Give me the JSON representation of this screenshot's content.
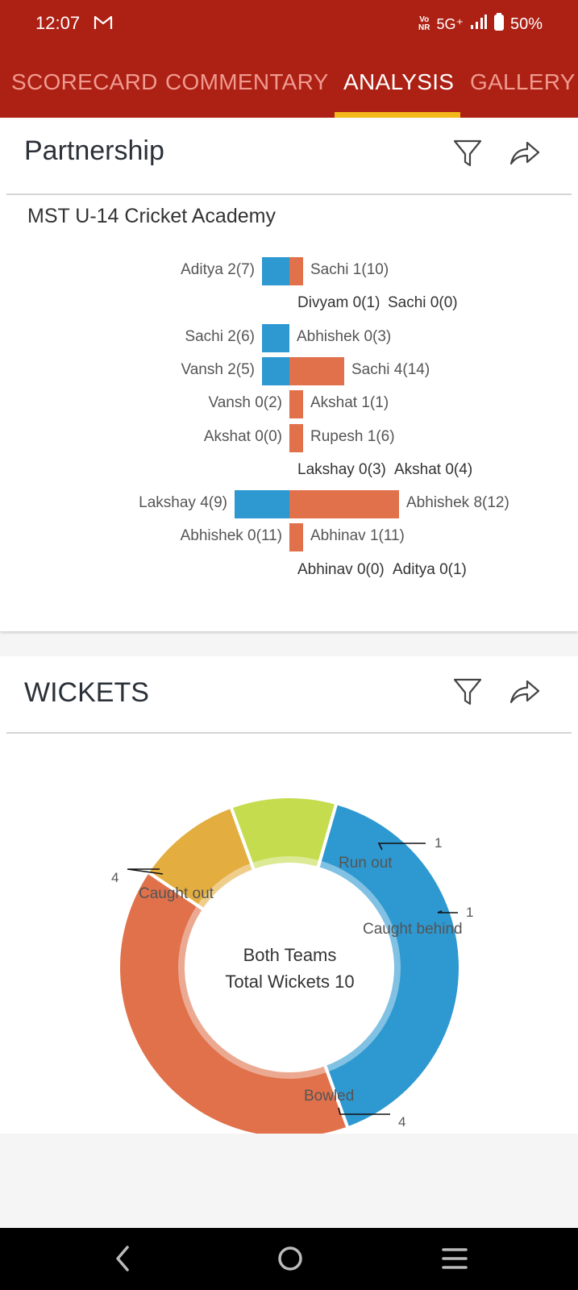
{
  "status_bar": {
    "time": "12:07",
    "network": "5G⁺",
    "battery": "50%",
    "icons": [
      "gmail-icon",
      "volte-icon",
      "signal-icon",
      "battery-icon"
    ]
  },
  "tabs": [
    {
      "label": "SCORECARD",
      "active": false
    },
    {
      "label": "COMMENTARY",
      "active": false
    },
    {
      "label": "ANALYSIS",
      "active": true
    },
    {
      "label": "GALLERY",
      "active": false
    }
  ],
  "partnership": {
    "title": "Partnership",
    "team": "MST U-14 Cricket Academy",
    "rows": [
      {
        "left": "Aditya 2(7)",
        "right": "Sachi 1(10)",
        "left_runs": 2,
        "right_runs": 1
      },
      {
        "left": "Divyam 0(1)",
        "right": "Sachi 0(0)",
        "left_runs": 0,
        "right_runs": 0
      },
      {
        "left": "Sachi 2(6)",
        "right": "Abhishek 0(3)",
        "left_runs": 2,
        "right_runs": 0
      },
      {
        "left": "Vansh 2(5)",
        "right": "Sachi 4(14)",
        "left_runs": 2,
        "right_runs": 4
      },
      {
        "left": "Vansh 0(2)",
        "right": "Akshat 1(1)",
        "left_runs": 0,
        "right_runs": 1
      },
      {
        "left": "Akshat 0(0)",
        "right": "Rupesh 1(6)",
        "left_runs": 0,
        "right_runs": 1
      },
      {
        "left": "Lakshay 0(3)",
        "right": "Akshat 0(4)",
        "left_runs": 0,
        "right_runs": 0
      },
      {
        "left": "Lakshay 4(9)",
        "right": "Abhishek 8(12)",
        "left_runs": 4,
        "right_runs": 8
      },
      {
        "left": "Abhishek 0(11)",
        "right": "Abhinav 1(11)",
        "left_runs": 0,
        "right_runs": 1
      },
      {
        "left": "Abhinav 0(0)",
        "right": "Aditya 0(1)",
        "left_runs": 0,
        "right_runs": 0
      }
    ]
  },
  "wickets": {
    "title": "WICKETS",
    "center_line1": "Both Teams",
    "center_line2": "Total Wickets 10",
    "chart_data": {
      "type": "pie",
      "style": "donut",
      "categories": [
        "Run out",
        "Caught behind",
        "Bowled",
        "Caught out"
      ],
      "values": [
        1,
        1,
        4,
        4
      ],
      "colors": [
        "#e4ad3f",
        "#c5dc4f",
        "#2e98d0",
        "#e0714a"
      ]
    },
    "value_labels": [
      "1",
      "1",
      "4",
      "4"
    ]
  },
  "nav": {
    "icons": [
      "back-icon",
      "home-icon",
      "recents-icon"
    ]
  }
}
